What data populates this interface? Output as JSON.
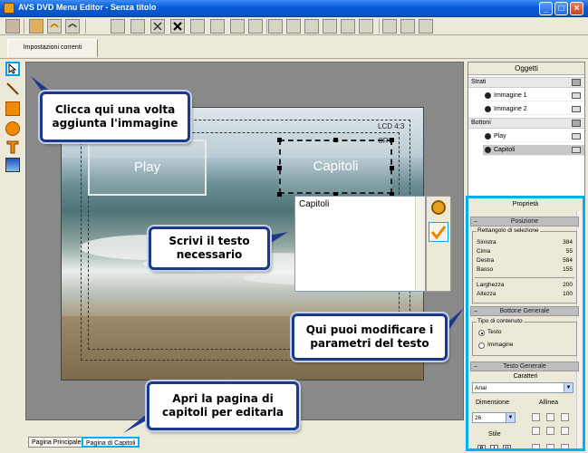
{
  "window": {
    "title": "AVS DVD Menu Editor - Senza titolo",
    "controls": [
      "_",
      "□",
      "×"
    ]
  },
  "tabs": {
    "settings": "Impostazioni correnti"
  },
  "tools": [
    "arrow-tool-icon",
    "line-tool-icon",
    "rectangle-tool-icon",
    "ellipse-tool-icon",
    "text-tool-icon",
    "image-tool-icon"
  ],
  "canvas": {
    "safe_labels": {
      "lcd": "LCD 4:3",
      "crt": "CRT"
    },
    "buttons": {
      "play": "Play",
      "capitoli": "Capitoli"
    },
    "edit_text": "Capitoli"
  },
  "callouts": {
    "add_image": "Clicca qui una volta aggiunta l'immagine",
    "write_text": "Scrivi il testo necessario",
    "edit_params": "Qui puoi modificare i parametri del testo",
    "open_page": "Apri la pagina di capitoli per editarla"
  },
  "pages": {
    "main": "Pagina Principale",
    "chapters": "Pagina di Capitoli"
  },
  "objects": {
    "title": "Oggetti",
    "layers_label": "Strati",
    "layers": [
      "Immagine 1",
      "Immagine 2"
    ],
    "buttons_label": "Bottoni",
    "buttons": [
      "Play",
      "Capitoli"
    ]
  },
  "properties": {
    "title": "Proprietà",
    "position": {
      "title": "Posizione",
      "group": "Rettangolo di selezione",
      "rows": [
        {
          "label": "Sinistra",
          "value": "384"
        },
        {
          "label": "Cima",
          "value": "55"
        },
        {
          "label": "Destra",
          "value": "584"
        },
        {
          "label": "Basso",
          "value": "155"
        }
      ],
      "size_rows": [
        {
          "label": "Larghezza",
          "value": "200"
        },
        {
          "label": "Altezza",
          "value": "100"
        }
      ]
    },
    "general_button": {
      "title": "Bottone Generale",
      "group": "Tipo di contenuto",
      "options": [
        "Testo",
        "Immagine"
      ]
    },
    "general_text": {
      "title": "Testo Generale",
      "font_label": "Caratteri",
      "font_value": "Arial",
      "size_label": "Dimensione",
      "size_value": "26",
      "align_label": "Allinea",
      "style_label": "Stile",
      "style_buttons": [
        "B",
        "I",
        "U"
      ]
    }
  },
  "colors": {
    "highlight": "#00b0f0",
    "callout_border": "#1b3a8c",
    "titlebar": "#0a5cd8"
  }
}
